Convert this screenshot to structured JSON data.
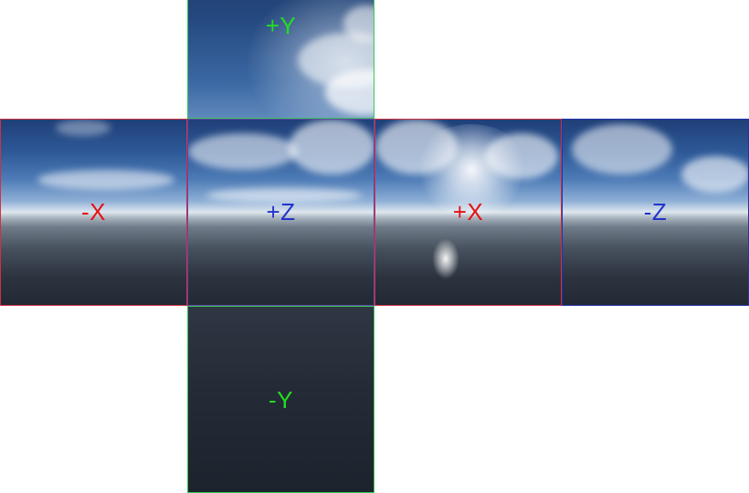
{
  "faces": {
    "pos_y": {
      "label": "+Y",
      "color": "#2ecc40"
    },
    "neg_x": {
      "label": "-X",
      "color": "#e01010"
    },
    "pos_z": {
      "label": "+Z",
      "color": "#2030c0"
    },
    "pos_x": {
      "label": "+X",
      "color": "#e01010"
    },
    "neg_z": {
      "label": "-Z",
      "color": "#2030c0"
    },
    "neg_y": {
      "label": "-Y",
      "color": "#2ecc40"
    }
  }
}
